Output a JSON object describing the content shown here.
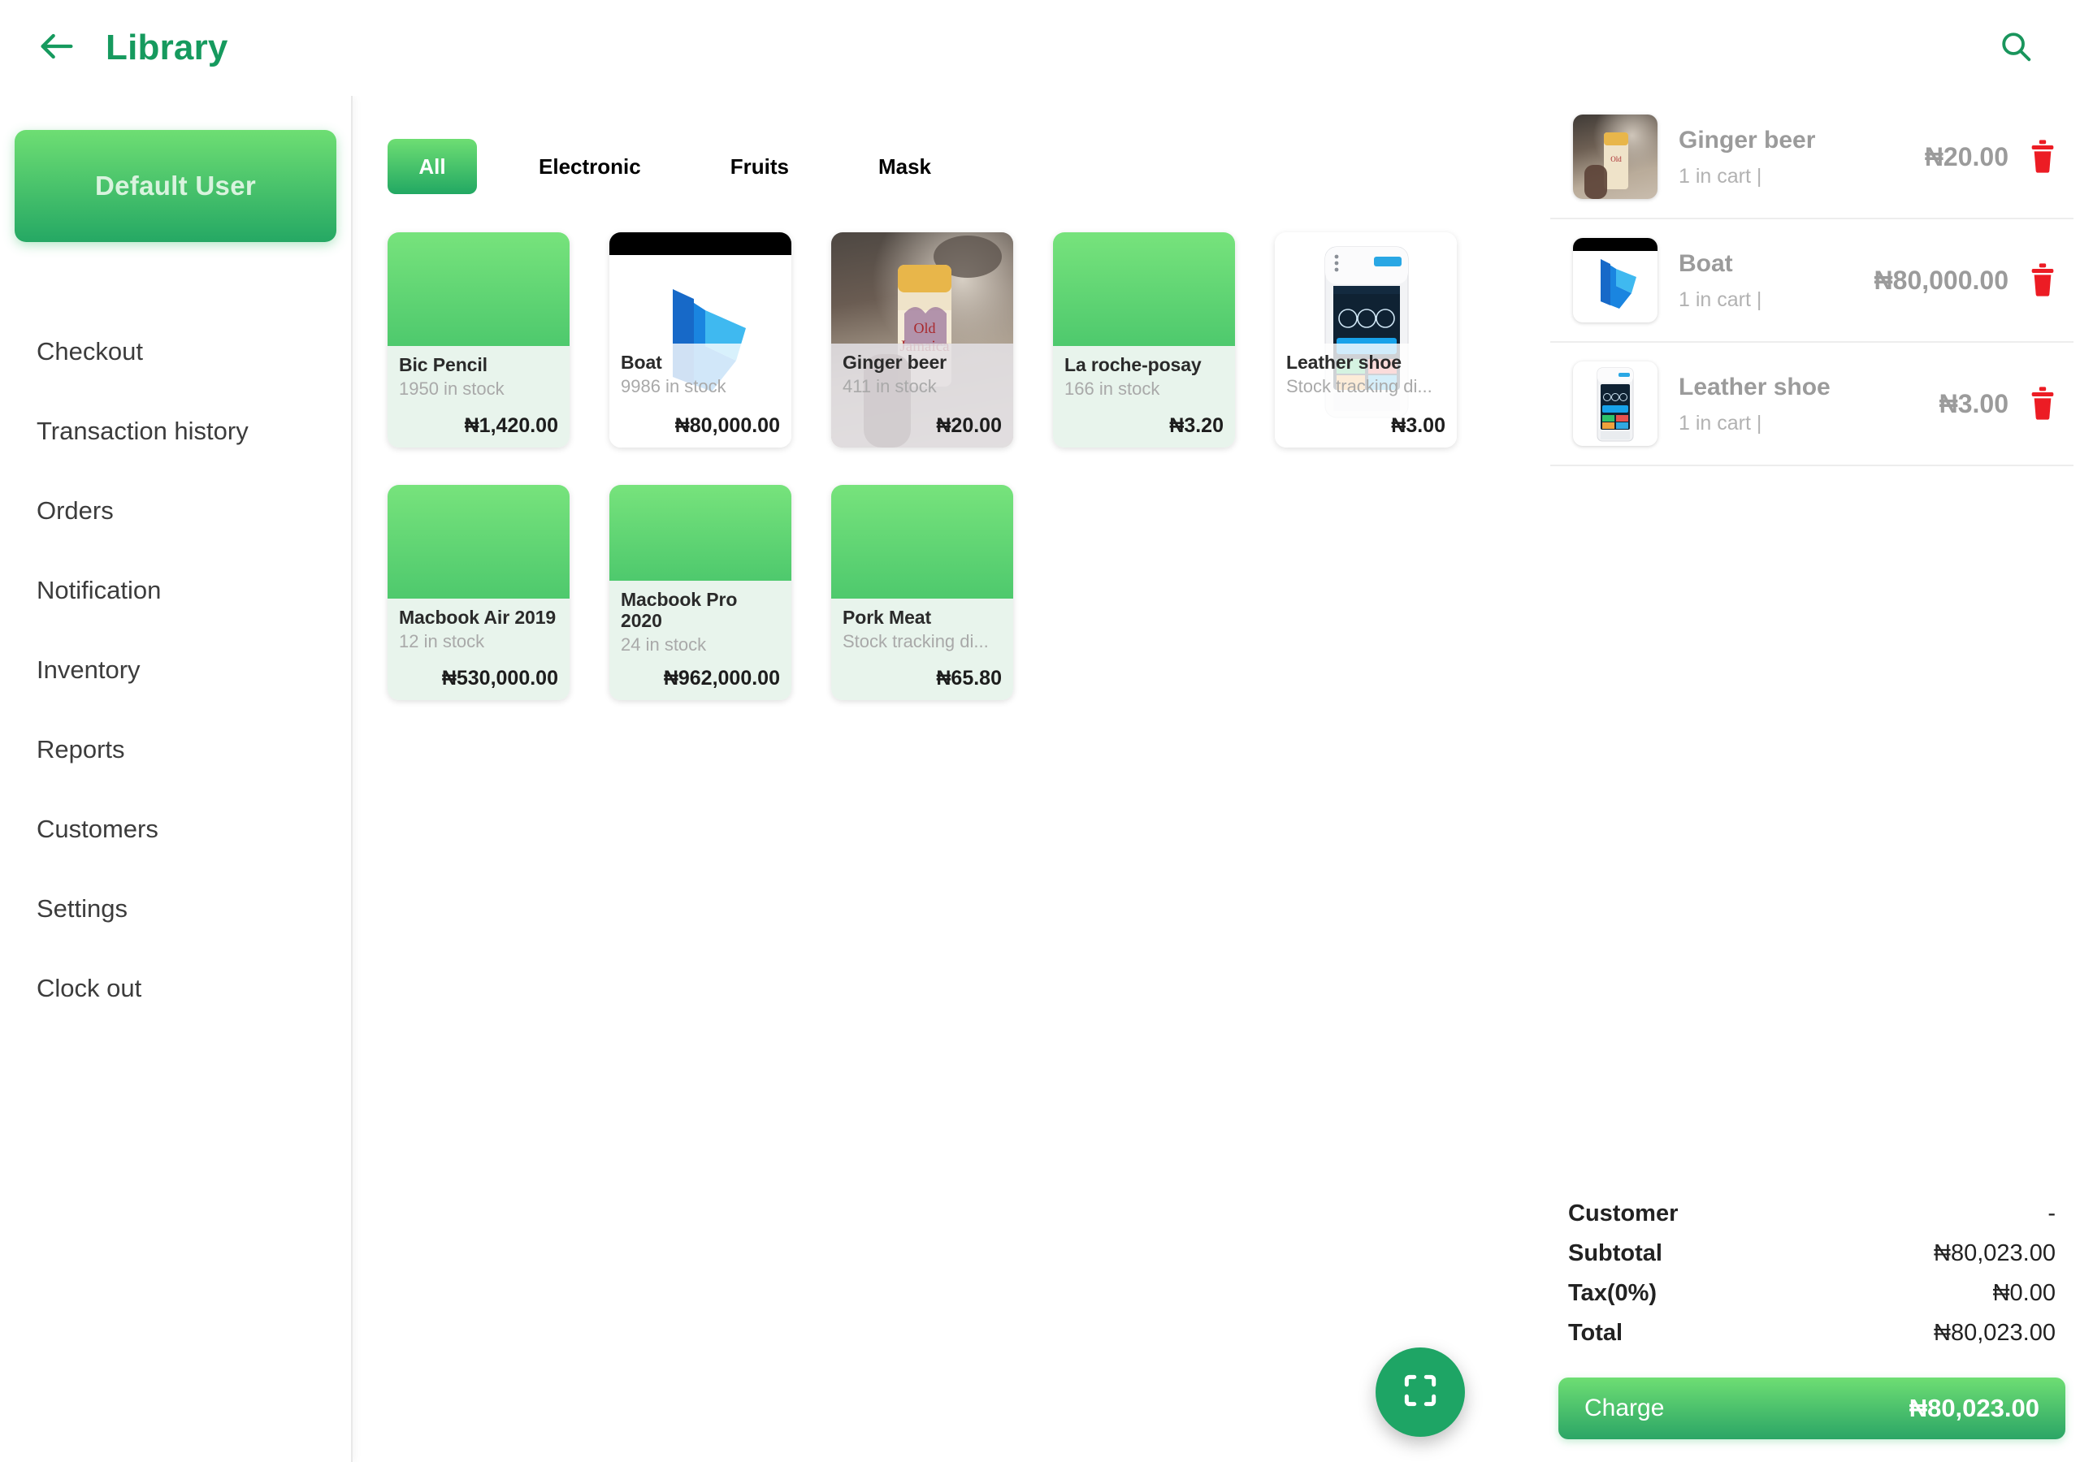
{
  "header": {
    "title": "Library",
    "back_icon": "arrow-left-icon",
    "search_icon": "search-icon"
  },
  "sidebar": {
    "user_chip": "Default User",
    "items": [
      {
        "label": "Checkout"
      },
      {
        "label": "Transaction history"
      },
      {
        "label": "Orders"
      },
      {
        "label": "Notification"
      },
      {
        "label": "Inventory"
      },
      {
        "label": "Reports"
      },
      {
        "label": "Customers"
      },
      {
        "label": "Settings"
      },
      {
        "label": "Clock out"
      }
    ]
  },
  "main": {
    "tabs": [
      {
        "label": "All",
        "active": true
      },
      {
        "label": "Electronic",
        "active": false
      },
      {
        "label": "Fruits",
        "active": false
      },
      {
        "label": "Mask",
        "active": false
      }
    ],
    "products": [
      {
        "name": "Bic Pencil",
        "stock": "1950 in stock",
        "price": "₦1,420.00"
      },
      {
        "name": "Boat",
        "stock": "9986 in stock",
        "price": "₦80,000.00"
      },
      {
        "name": "Ginger beer",
        "stock": "411 in stock",
        "price": "₦20.00"
      },
      {
        "name": "La roche-posay",
        "stock": "166 in stock",
        "price": "₦3.20"
      },
      {
        "name": "Leather shoe",
        "stock": "Stock tracking di...",
        "price": "₦3.00"
      },
      {
        "name": "Macbook Air 2019",
        "stock": "12 in stock",
        "price": "₦530,000.00"
      },
      {
        "name": "Macbook Pro 2020",
        "stock": "24 in stock",
        "price": "₦962,000.00"
      },
      {
        "name": "Pork Meat",
        "stock": "Stock tracking di...",
        "price": "₦65.80"
      }
    ],
    "scan_fab_icon": "scan-frame-icon"
  },
  "cart": {
    "items": [
      {
        "name": "Ginger beer",
        "qty": "1 in cart  |",
        "price": "₦20.00",
        "delete_icon": "trash-icon"
      },
      {
        "name": "Boat",
        "qty": "1 in cart  |",
        "price": "₦80,000.00",
        "delete_icon": "trash-icon"
      },
      {
        "name": "Leather shoe",
        "qty": "1 in cart  |",
        "price": "₦3.00",
        "delete_icon": "trash-icon"
      }
    ],
    "totals": [
      {
        "label": "Customer",
        "value": "-"
      },
      {
        "label": "Subtotal",
        "value": "₦80,023.00"
      },
      {
        "label": "Tax(0%)",
        "value": "₦0.00"
      },
      {
        "label": "Total",
        "value": "₦80,023.00"
      }
    ],
    "charge": {
      "label": "Charge",
      "amount": "₦80,023.00"
    }
  },
  "colors": {
    "brand_green": "#169a5e",
    "accent_gradient_top": "#6ede73",
    "accent_gradient_bottom": "#22a863",
    "delete_red": "#ec1c24",
    "card_body": "#e8f4ec"
  }
}
